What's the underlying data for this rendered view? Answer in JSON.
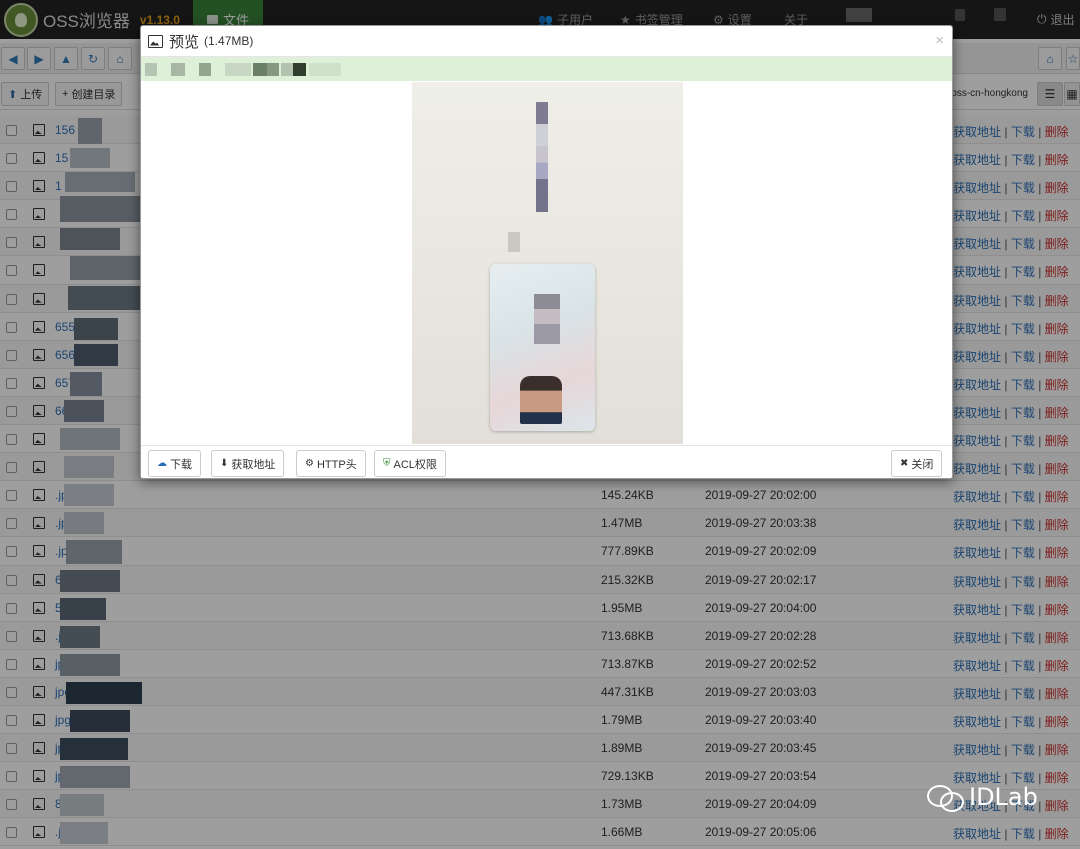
{
  "navbar": {
    "app_name": "OSS浏览器",
    "version": "v1.13.0",
    "file_tab": "文件",
    "subuser": "子用户",
    "bookmarks": "书签管理",
    "settings": "设置",
    "about": "关于",
    "logout": "退出"
  },
  "toolbar": {
    "upload": "上传",
    "create_dir": "创建目录",
    "region": "oss-cn-hongkong"
  },
  "files": [
    {
      "name": "156",
      "size": "",
      "date": ""
    },
    {
      "name": "15",
      "size": "",
      "date": ""
    },
    {
      "name": "1",
      "size": "",
      "date": ""
    },
    {
      "name": "",
      "size": "",
      "date": ""
    },
    {
      "name": "",
      "size": "",
      "date": ""
    },
    {
      "name": "",
      "size": "",
      "date": ""
    },
    {
      "name": "",
      "size": "",
      "date": ""
    },
    {
      "name": "655.jp",
      "size": "",
      "date": ""
    },
    {
      "name": "656.jp",
      "size": "",
      "date": ""
    },
    {
      "name": "657.jp",
      "size": "",
      "date": ""
    },
    {
      "name": "668.jp",
      "size": "",
      "date": ""
    },
    {
      "name": "",
      "size": "",
      "date": ""
    },
    {
      "name": "",
      "size": "",
      "date": ""
    },
    {
      "name": ".jpg",
      "size": "145.24KB",
      "date": "2019-09-27 20:02:00"
    },
    {
      "name": ".jpg",
      "size": "1.47MB",
      "date": "2019-09-27 20:03:38"
    },
    {
      "name": ".jpg",
      "size": "777.89KB",
      "date": "2019-09-27 20:02:09"
    },
    {
      "name": "6.jpg",
      "size": "215.32KB",
      "date": "2019-09-27 20:02:17"
    },
    {
      "name": "5.jpg",
      "size": "1.95MB",
      "date": "2019-09-27 20:04:00"
    },
    {
      "name": ".jpg",
      "size": "713.68KB",
      "date": "2019-09-27 20:02:28"
    },
    {
      "name": "jpg",
      "size": "713.87KB",
      "date": "2019-09-27 20:02:52"
    },
    {
      "name": "jpg",
      "size": "447.31KB",
      "date": "2019-09-27 20:03:03"
    },
    {
      "name": "jpg",
      "size": "1.79MB",
      "date": "2019-09-27 20:03:40"
    },
    {
      "name": "jpg",
      "size": "1.89MB",
      "date": "2019-09-27 20:03:45"
    },
    {
      "name": "jpg",
      "size": "729.13KB",
      "date": "2019-09-27 20:03:54"
    },
    {
      "name": "848.jpg",
      "size": "1.73MB",
      "date": "2019-09-27 20:04:09"
    },
    {
      "name": ".jpg",
      "size": "1.66MB",
      "date": "2019-09-27 20:05:06"
    }
  ],
  "actions": {
    "get_url": "获取地址",
    "download": "下载",
    "delete": "删除",
    "sep": "|"
  },
  "modal": {
    "title": "预览",
    "size": "(1.47MB)",
    "close_x": "×",
    "buttons": {
      "download": "下载",
      "get_url": "获取地址",
      "http_header": "HTTP头",
      "acl": "ACL权限",
      "close": "关闭"
    }
  },
  "watermark": "IDLab",
  "colors": {
    "navbar_bg": "#222222",
    "file_tab_bg": "#398439",
    "version": "#e8a317",
    "link": "#2a6fb7",
    "delete": "#c9302c",
    "path_bar": "#dff0d8"
  }
}
